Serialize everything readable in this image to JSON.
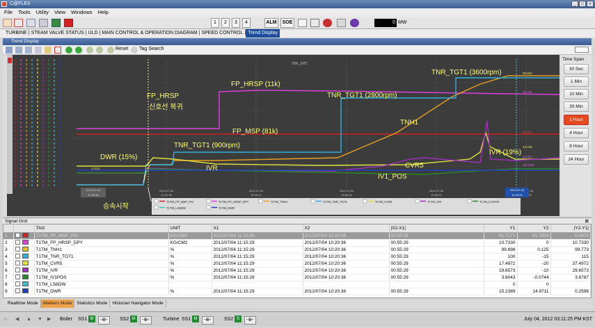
{
  "window": {
    "title": "C@FLEX"
  },
  "menu": [
    "File",
    "Tools",
    "Utility",
    "View",
    "Windows",
    "Help"
  ],
  "toolbar": {
    "pages": [
      "1",
      "2",
      "3",
      "4"
    ],
    "alm": "ALM",
    "soe": "SOE",
    "mw_value": "0",
    "mw_unit": "MW"
  },
  "nav": {
    "tabs": [
      "TURBINE",
      "STEAM VALVE STATUS",
      "ULD",
      "MAIN CONTROL & OPERATION DIAGRAM",
      "SPEED CONTROL",
      "Trend Display"
    ],
    "active": "Trend Display"
  },
  "trend": {
    "panel_title": "Trend Display",
    "reset_label": "Reset",
    "tag_search_label": "Tag Search",
    "plot_title": "TBN_SPD",
    "time_ticks": [
      {
        "date": "2012-07-04",
        "time": "10:01:36"
      },
      {
        "date": "2012-07-04",
        "time": "10:43:12"
      },
      {
        "date": "2012-07-04",
        "time": "10:54:48"
      },
      {
        "date": "2012-07-04",
        "time": "11:06:24"
      },
      {
        "date": "2012-07-04",
        "time": "11:18:00"
      }
    ],
    "cursor_left": {
      "date": "2012-07-04",
      "time": "10:20:36"
    },
    "cursor_right": {
      "date": "2012-07-04",
      "time": "11:15:29"
    },
    "value_labels_right": [
      "99.894",
      "81.734",
      "16.724",
      "15.235",
      "12.354",
      "10.7330"
    ],
    "value_label_left": "0.131",
    "annotations": [
      "FP_HRSP",
      "신호선 복귀",
      "FP_HRSP (11k)",
      "FP_MSP (81k)",
      "DWR (15%)",
      "TNR_TGT1 (900rpm)",
      "TNR_TGT1 (2800rpm)",
      "TNR_TGT1 (3600rpm)",
      "TNH1",
      "IVR",
      "IVR (19%)",
      "CVR5",
      "IV1_POS",
      "승속시작"
    ],
    "legend": [
      "T1TM_FP_MSP_PSI",
      "T1TM_FP_HRSP_DPY",
      "T1TM_TNH1",
      "T1TM_TNR_TGT1",
      "T1TM_CVR5",
      "T1TM_IVR",
      "T1TM_IV1POS",
      "T1TM_LS8DW",
      "T1TM_DWR"
    ]
  },
  "chart_data": {
    "type": "line",
    "title": "TBN_SPD",
    "x": [
      "10:01",
      "10:20",
      "10:43",
      "10:54",
      "11:06",
      "11:15",
      "11:18"
    ],
    "series": [
      {
        "name": "T1TM_FP_MSP_PSI",
        "color": "#cc2222",
        "values": [
          0,
          81.7,
          81.7,
          81.7,
          81.7,
          81.7,
          81.7
        ]
      },
      {
        "name": "T1TM_FP_HRSP_DPY",
        "color": "#e040e0",
        "values": [
          10.7,
          10.7,
          98,
          98,
          97,
          96,
          96
        ]
      },
      {
        "name": "T1TM_TNH1",
        "color": "#e8a020",
        "values": [
          0,
          15,
          30,
          45,
          80,
          99,
          99
        ]
      },
      {
        "name": "T1TM_TNR_TGT1",
        "color": "#30b0e0",
        "values": [
          0,
          25,
          25,
          62,
          78,
          100,
          100
        ]
      },
      {
        "name": "T1TM_CVR5",
        "color": "#e0e040",
        "values": [
          0,
          8,
          4,
          3,
          8,
          20,
          16
        ]
      },
      {
        "name": "T1TM_IVR",
        "color": "#a030c0",
        "values": [
          0,
          5,
          3,
          2,
          3,
          19,
          10
        ]
      },
      {
        "name": "T1TM_IV1POS",
        "color": "#2a8a2a",
        "values": [
          0,
          0.4,
          0.3,
          1,
          2,
          3.6,
          3.6
        ]
      }
    ]
  },
  "time_spans": [
    "30 Sec",
    "1 Min",
    "10 Min",
    "30 Min",
    "1 Hour",
    "4 Hour",
    "8 Hour",
    "24 Hour"
  ],
  "time_span_selected": "1 Hour",
  "signal_grid": {
    "title": "Signal Grid",
    "columns": [
      "",
      "",
      "TAG",
      "UNIT",
      "X1",
      "X2",
      "|X2-X1|",
      "Y1",
      "Y2",
      "|Y2-Y1|"
    ],
    "rows": [
      {
        "n": "1",
        "color": "#cc2222",
        "tag": "T1TM_FP_MSP_PSI",
        "unit": "KG/CM2",
        "x1": "2012/07/04 11:15:29",
        "x2": "2012/07/04 10:20:36",
        "dx": "00:55:29",
        "y1": "81.7171",
        "y2": "81.7834",
        "dy": "0.0403"
      },
      {
        "n": "2",
        "color": "#e040e0",
        "tag": "T1TM_FP_HRSP_DPY",
        "unit": "KG/CM2",
        "x1": "2012/07/04 11:15:29",
        "x2": "2012/07/04 10:20:36",
        "dx": "00:55:29",
        "y1": "10.7330",
        "y2": "0",
        "dy": "10.7330"
      },
      {
        "n": "3",
        "color": "#e8c020",
        "tag": "T1TM_TNH1",
        "unit": "%",
        "x1": "2012/07/04 11:15:29",
        "x2": "2012/07/04 10:20:36",
        "dx": "00:55:29",
        "y1": "99.898",
        "y2": "0.125",
        "dy": "99.773"
      },
      {
        "n": "4",
        "color": "#30b0e0",
        "tag": "T1TM_TNR_TGT1",
        "unit": "%",
        "x1": "2012/07/04 11:15:29",
        "x2": "2012/07/04 10:20:36",
        "dx": "00:55:29",
        "y1": "100",
        "y2": "-15",
        "dy": "115"
      },
      {
        "n": "5",
        "color": "#e0e040",
        "tag": "T1TM_CVR5",
        "unit": "%",
        "x1": "2012/07/04 11:15:29",
        "x2": "2012/07/04 10:20:36",
        "dx": "00:55:29",
        "y1": "17.4972",
        "y2": "-20",
        "dy": "37.4972"
      },
      {
        "n": "6",
        "color": "#a030c0",
        "tag": "T1TM_IVR",
        "unit": "%",
        "x1": "2012/07/04 11:15:29",
        "x2": "2012/07/04 10:20:36",
        "dx": "00:55:29",
        "y1": "19.6573",
        "y2": "-10",
        "dy": "29.6573"
      },
      {
        "n": "7",
        "color": "#2a8a2a",
        "tag": "T1TM_IV1POS",
        "unit": "%",
        "x1": "2012/07/04 11:15:29",
        "x2": "2012/07/04 10:20:36",
        "dx": "00:55:29",
        "y1": "3.6043",
        "y2": "-0.0744",
        "dy": "3.6787"
      },
      {
        "n": "8",
        "color": "#40c0d0",
        "tag": "T1TM_LS8DW",
        "unit": "",
        "x1": "",
        "x2": "",
        "dx": "",
        "y1": "0",
        "y2": "0",
        "dy": ""
      },
      {
        "n": "9",
        "color": "#2040c0",
        "tag": "T1TM_DWR",
        "unit": "%",
        "x1": "2012/07/04 11:15:29",
        "x2": "2012/07/04 10:20:36",
        "dx": "00:55:29",
        "y1": "15.2389",
        "y2": "14.9711",
        "dy": "0.2598"
      }
    ]
  },
  "mode_tabs": [
    "Realtime Mode",
    "Markers Mode",
    "Statistics Mode",
    "Historian Navigator Mode"
  ],
  "mode_active": "Markers Mode",
  "status": {
    "boiler": "Boiler",
    "ss1": "SS1",
    "ss2": "SS2",
    "turbine": "Turbine",
    "datetime": "July 04, 2012 03:11:25 PM KST",
    "m": "M",
    "s": "S"
  }
}
